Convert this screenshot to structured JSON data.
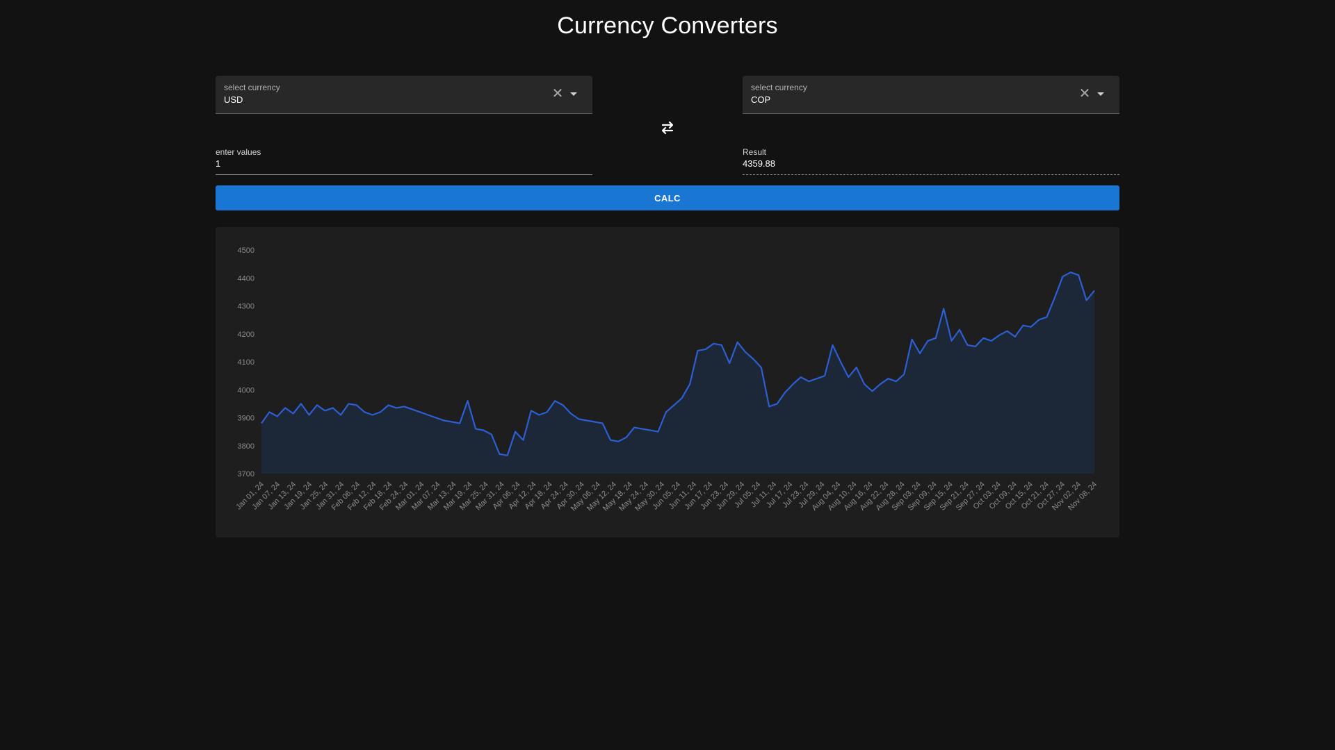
{
  "page": {
    "title": "Currency Converters"
  },
  "from": {
    "label": "select currency",
    "value": "USD",
    "clear_icon": "close-icon",
    "dropdown_icon": "arrow-drop-down-icon"
  },
  "to": {
    "label": "select currency",
    "value": "COP",
    "clear_icon": "close-icon",
    "dropdown_icon": "arrow-drop-down-icon"
  },
  "swap": {
    "icon": "swap-horizontal-icon"
  },
  "input": {
    "label": "enter values",
    "value": "1"
  },
  "result": {
    "label": "Result",
    "value": "4359.88"
  },
  "calc_button": {
    "label": "CALC",
    "color": "#1976d2"
  },
  "chart_data": {
    "type": "area",
    "title": "",
    "xlabel": "",
    "ylabel": "",
    "ylim": [
      3700,
      4500
    ],
    "yticks": [
      "3700",
      "3800",
      "3900",
      "4000",
      "4100",
      "4200",
      "4300",
      "4400",
      "4500"
    ],
    "xticks": [
      "Jan 01, 24",
      "Jan 07, 24",
      "Jan 13, 24",
      "Jan 19, 24",
      "Jan 25, 24",
      "Jan 31, 24",
      "Feb 06, 24",
      "Feb 12, 24",
      "Feb 18, 24",
      "Feb 24, 24",
      "Mar 01, 24",
      "Mar 07, 24",
      "Mar 13, 24",
      "Mar 19, 24",
      "Mar 25, 24",
      "Mar 31, 24",
      "Apr 06, 24",
      "Apr 12, 24",
      "Apr 18, 24",
      "Apr 24, 24",
      "Apr 30, 24",
      "May 06, 24",
      "May 12, 24",
      "May 18, 24",
      "May 24, 24",
      "May 30, 24",
      "Jun 05, 24",
      "Jun 11, 24",
      "Jun 17, 24",
      "Jun 23, 24",
      "Jun 29, 24",
      "Jul 05, 24",
      "Jul 11, 24",
      "Jul 17, 24",
      "Jul 23, 24",
      "Jul 29, 24",
      "Aug 04, 24",
      "Aug 10, 24",
      "Aug 16, 24",
      "Aug 22, 24",
      "Aug 28, 24",
      "Sep 03, 24",
      "Sep 09, 24",
      "Sep 15, 24",
      "Sep 21, 24",
      "Sep 27, 24",
      "Oct 03, 24",
      "Oct 09, 24",
      "Oct 15, 24",
      "Oct 21, 24",
      "Oct 27, 24",
      "Nov 02, 24",
      "Nov 08, 24"
    ],
    "line_color": "#2d5fd4",
    "fill_color": "#1c2738",
    "grid": false,
    "series": [
      {
        "x": [
          "Jan 01, 24",
          "Jan 04, 24",
          "Jan 07, 24",
          "Jan 10, 24",
          "Jan 13, 24",
          "Jan 16, 24",
          "Jan 19, 24",
          "Jan 22, 24",
          "Jan 25, 24",
          "Jan 28, 24",
          "Jan 31, 24",
          "Feb 03, 24",
          "Feb 06, 24",
          "Feb 09, 24",
          "Feb 12, 24",
          "Feb 15, 24",
          "Feb 18, 24",
          "Feb 21, 24",
          "Feb 24, 24",
          "Feb 27, 24",
          "Mar 01, 24",
          "Mar 04, 24",
          "Mar 07, 24",
          "Mar 10, 24",
          "Mar 13, 24",
          "Mar 16, 24",
          "Mar 19, 24",
          "Mar 22, 24",
          "Mar 25, 24",
          "Mar 28, 24",
          "Mar 31, 24",
          "Apr 03, 24",
          "Apr 06, 24",
          "Apr 09, 24",
          "Apr 12, 24",
          "Apr 15, 24",
          "Apr 18, 24",
          "Apr 21, 24",
          "Apr 24, 24",
          "Apr 27, 24",
          "Apr 30, 24",
          "May 03, 24",
          "May 06, 24",
          "May 09, 24",
          "May 12, 24",
          "May 15, 24",
          "May 18, 24",
          "May 21, 24",
          "May 24, 24",
          "May 27, 24",
          "May 30, 24",
          "Jun 02, 24",
          "Jun 05, 24",
          "Jun 08, 24",
          "Jun 11, 24",
          "Jun 14, 24",
          "Jun 17, 24",
          "Jun 20, 24",
          "Jun 23, 24",
          "Jun 26, 24",
          "Jun 29, 24",
          "Jul 02, 24",
          "Jul 05, 24",
          "Jul 08, 24",
          "Jul 11, 24",
          "Jul 14, 24",
          "Jul 17, 24",
          "Jul 20, 24",
          "Jul 23, 24",
          "Jul 26, 24",
          "Jul 29, 24",
          "Aug 01, 24",
          "Aug 04, 24",
          "Aug 07, 24",
          "Aug 10, 24",
          "Aug 13, 24",
          "Aug 16, 24",
          "Aug 19, 24",
          "Aug 22, 24",
          "Aug 25, 24",
          "Aug 28, 24",
          "Aug 31, 24",
          "Sep 03, 24",
          "Sep 06, 24",
          "Sep 09, 24",
          "Sep 12, 24",
          "Sep 15, 24",
          "Sep 18, 24",
          "Sep 21, 24",
          "Sep 24, 24",
          "Sep 27, 24",
          "Sep 30, 24",
          "Oct 03, 24",
          "Oct 06, 24",
          "Oct 09, 24",
          "Oct 12, 24",
          "Oct 15, 24",
          "Oct 18, 24",
          "Oct 21, 24",
          "Oct 24, 24",
          "Oct 27, 24",
          "Oct 30, 24",
          "Nov 02, 24",
          "Nov 05, 24",
          "Nov 08, 24",
          "Nov 09, 24"
        ],
        "values": [
          3880,
          3920,
          3905,
          3935,
          3915,
          3950,
          3910,
          3945,
          3925,
          3935,
          3910,
          3950,
          3945,
          3920,
          3910,
          3920,
          3945,
          3935,
          3940,
          3930,
          3920,
          3910,
          3900,
          3890,
          3885,
          3880,
          3960,
          3860,
          3855,
          3840,
          3770,
          3765,
          3850,
          3820,
          3925,
          3910,
          3920,
          3960,
          3945,
          3915,
          3895,
          3890,
          3885,
          3880,
          3820,
          3815,
          3830,
          3865,
          3860,
          3855,
          3850,
          3920,
          3945,
          3970,
          4020,
          4140,
          4145,
          4165,
          4160,
          4095,
          4170,
          4135,
          4110,
          4080,
          3940,
          3950,
          3990,
          4020,
          4045,
          4030,
          4040,
          4050,
          4160,
          4100,
          4045,
          4080,
          4020,
          3995,
          4020,
          4040,
          4030,
          4055,
          4180,
          4130,
          4175,
          4185,
          4290,
          4175,
          4215,
          4160,
          4155,
          4185,
          4175,
          4195,
          4210,
          4190,
          4230,
          4225,
          4250,
          4260,
          4330,
          4405,
          4420,
          4410,
          4320,
          4355
        ]
      }
    ]
  }
}
